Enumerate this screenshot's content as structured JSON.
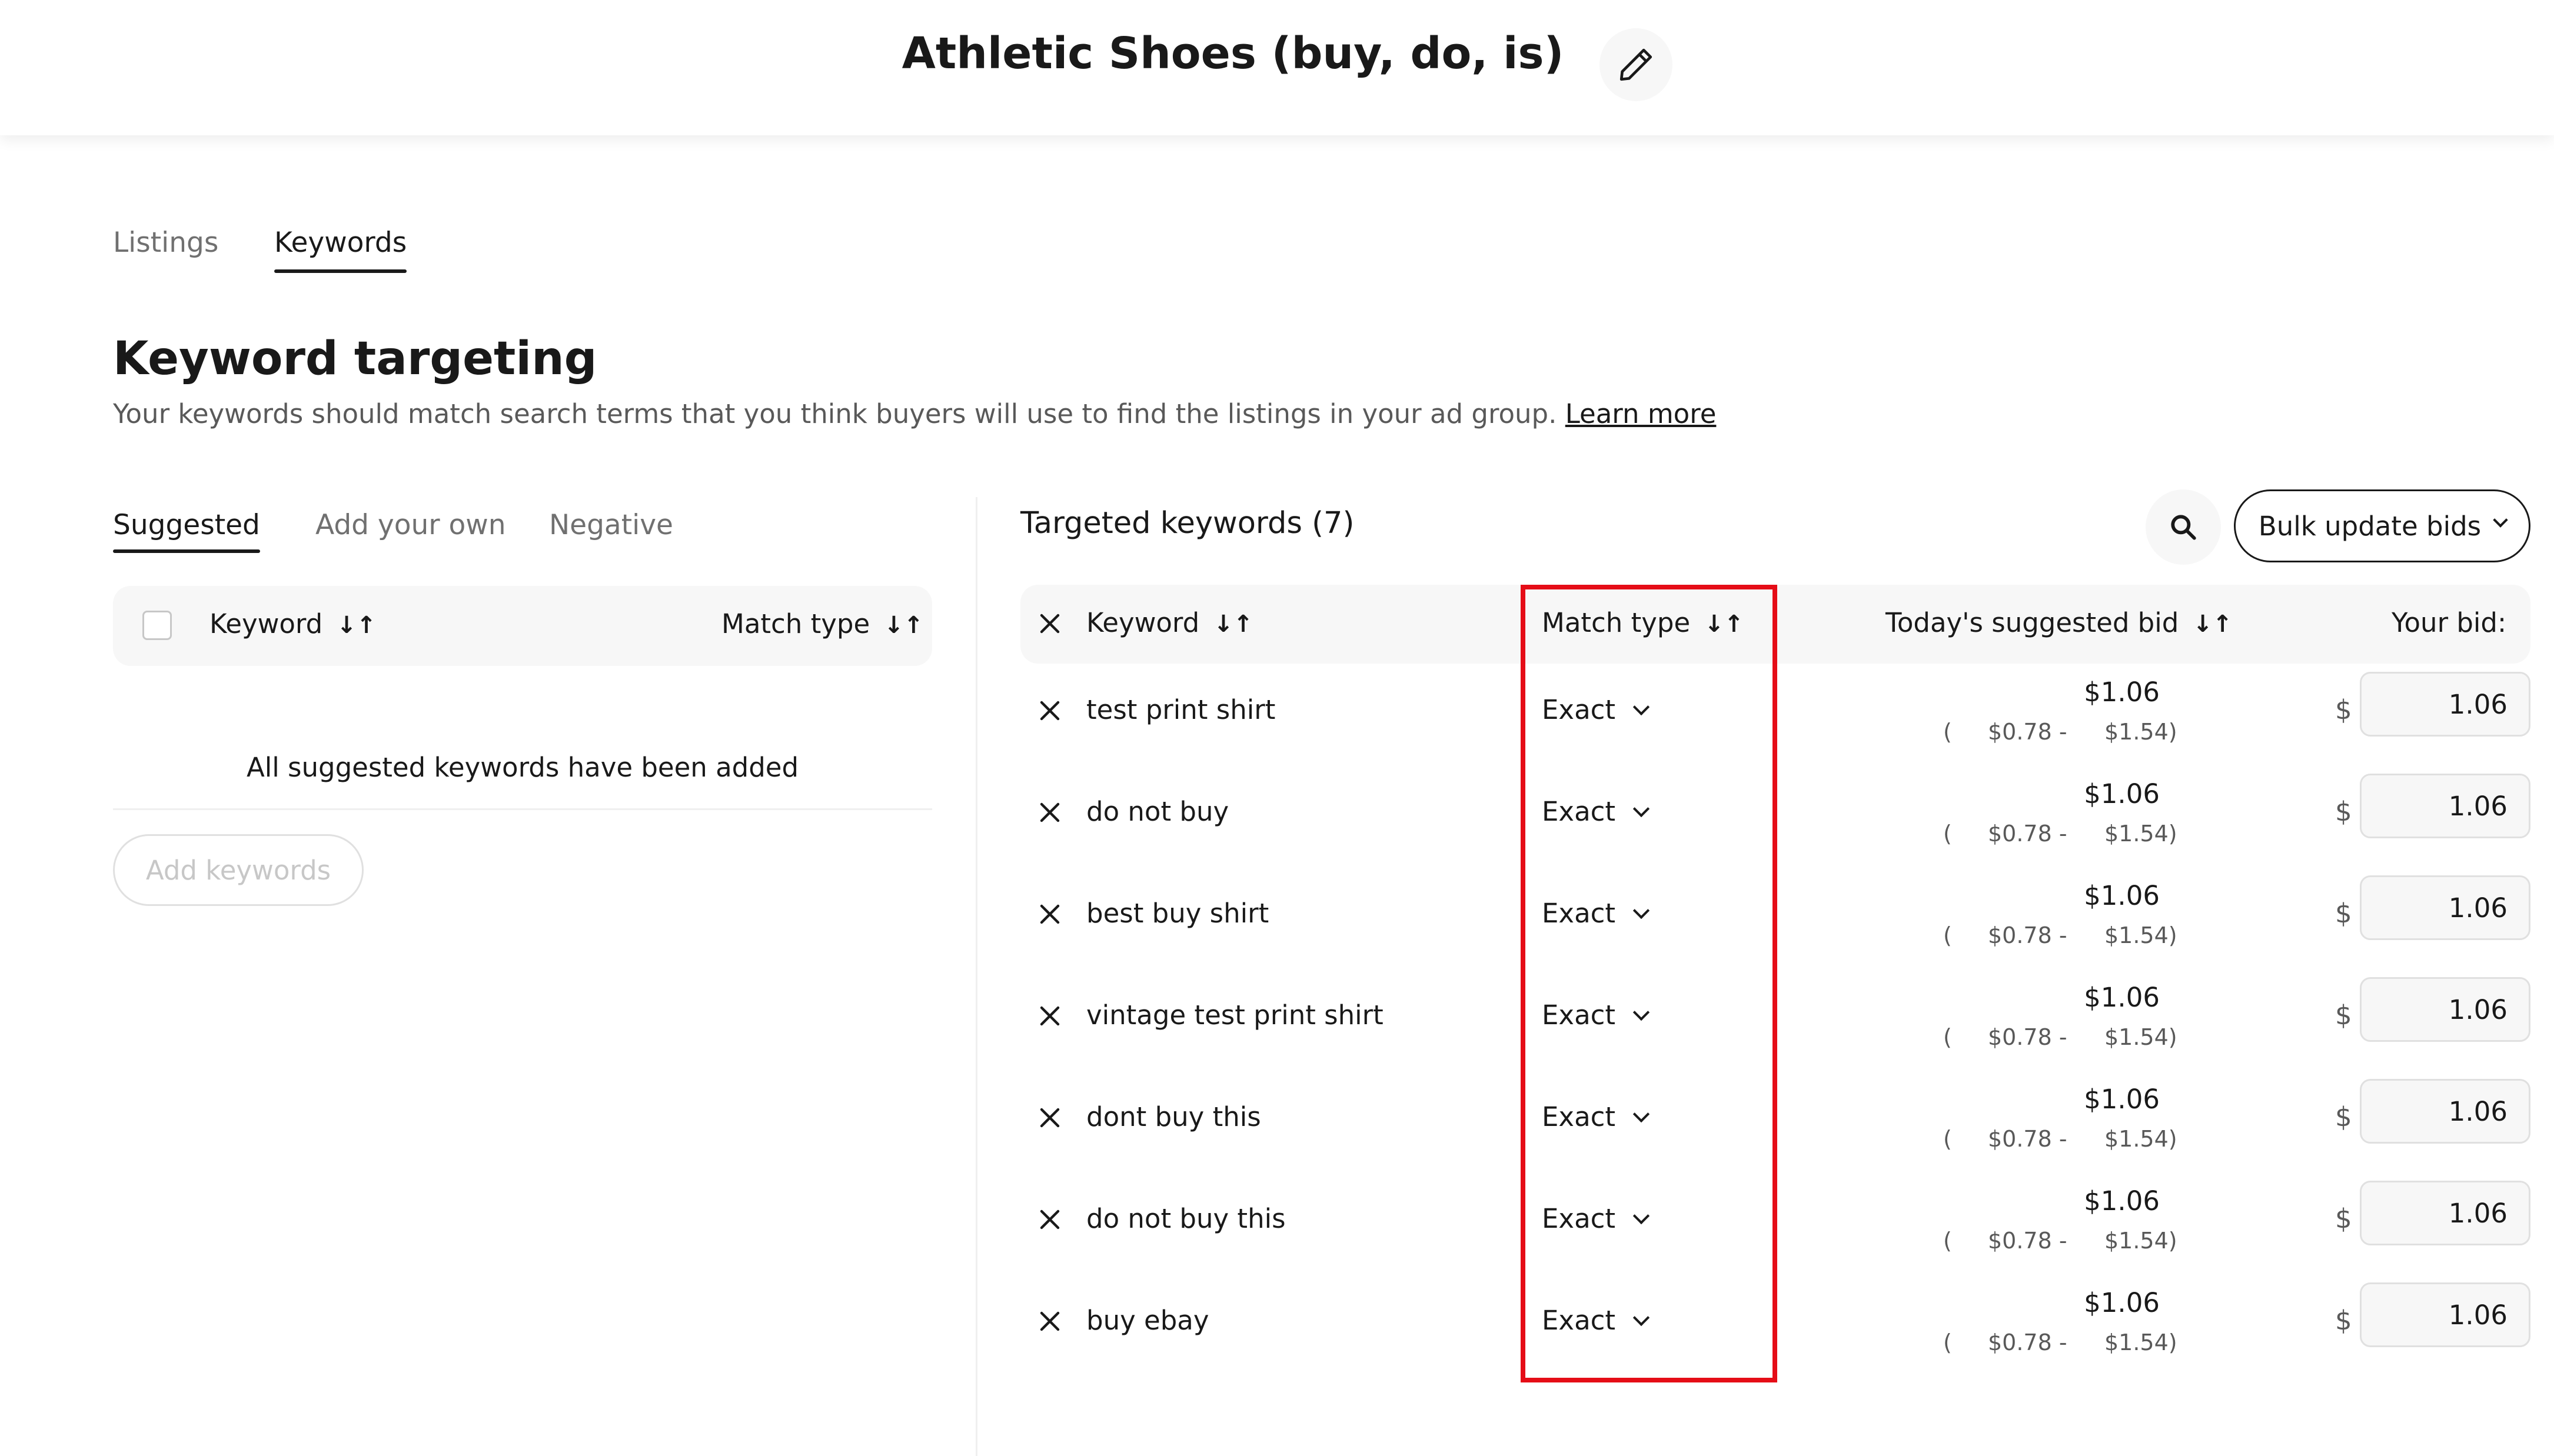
{
  "header": {
    "title": "Athletic Shoes (buy, do, is)"
  },
  "tabs": [
    {
      "label": "Listings"
    },
    {
      "label": "Keywords"
    }
  ],
  "keyword_targeting": {
    "heading": "Keyword targeting",
    "description": "Your keywords should match search terms that you think buyers will use to find the listings in your ad group.",
    "learn_more": "Learn more"
  },
  "left_panel": {
    "subtabs": [
      {
        "label": "Suggested"
      },
      {
        "label": "Add your own"
      },
      {
        "label": "Negative"
      }
    ],
    "col_keyword": "Keyword",
    "col_match_type": "Match type",
    "empty_message": "All suggested keywords have been added",
    "add_button": "Add keywords"
  },
  "right_panel": {
    "title": "Targeted keywords (7)",
    "bulk_button": "Bulk update bids",
    "columns": {
      "keyword": "Keyword",
      "match_type": "Match type",
      "suggested_bid": "Today's suggested bid",
      "your_bid": "Your bid:"
    },
    "currency": "$",
    "rows": [
      {
        "keyword": "test print shirt",
        "match": "Exact",
        "bid": "$1.06",
        "range_low": "$0.78 -",
        "range_high": "$1.54)",
        "your_bid": "1.06"
      },
      {
        "keyword": "do not buy",
        "match": "Exact",
        "bid": "$1.06",
        "range_low": "$0.78 -",
        "range_high": "$1.54)",
        "your_bid": "1.06"
      },
      {
        "keyword": "best buy shirt",
        "match": "Exact",
        "bid": "$1.06",
        "range_low": "$0.78 -",
        "range_high": "$1.54)",
        "your_bid": "1.06"
      },
      {
        "keyword": "vintage test print shirt",
        "match": "Exact",
        "bid": "$1.06",
        "range_low": "$0.78 -",
        "range_high": "$1.54)",
        "your_bid": "1.06"
      },
      {
        "keyword": "dont buy this",
        "match": "Exact",
        "bid": "$1.06",
        "range_low": "$0.78 -",
        "range_high": "$1.54)",
        "your_bid": "1.06"
      },
      {
        "keyword": "do not buy this",
        "match": "Exact",
        "bid": "$1.06",
        "range_low": "$0.78 -",
        "range_high": "$1.54)",
        "your_bid": "1.06"
      },
      {
        "keyword": "buy ebay",
        "match": "Exact",
        "bid": "$1.06",
        "range_low": "$0.78 -",
        "range_high": "$1.54)",
        "your_bid": "1.06"
      }
    ]
  },
  "colors": {
    "highlight": "#e50d17",
    "text": "#191919",
    "muted": "#707070",
    "panel": "#f7f7f7"
  }
}
